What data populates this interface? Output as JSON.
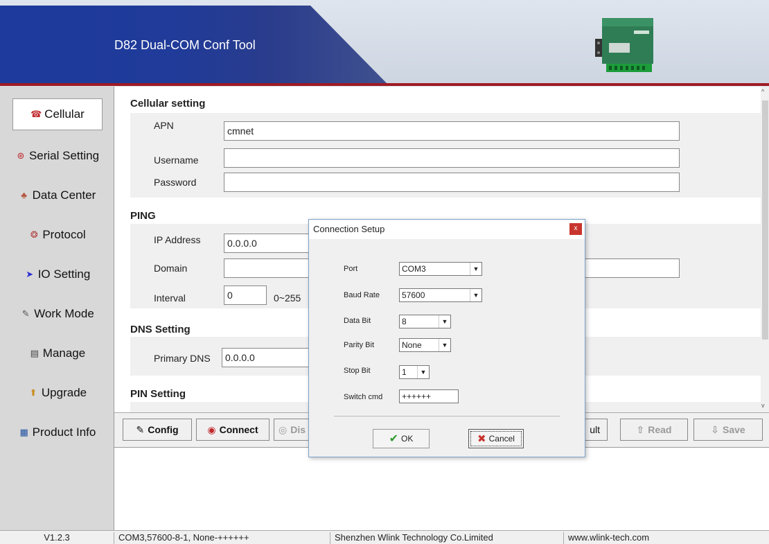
{
  "app": {
    "title": "D82 Dual-COM Conf Tool"
  },
  "sidebar": {
    "items": [
      {
        "label": "Cellular",
        "icon": "phone-icon"
      },
      {
        "label": "Serial Setting",
        "icon": "serial-icon"
      },
      {
        "label": "Data Center",
        "icon": "network-icon"
      },
      {
        "label": "Protocol",
        "icon": "protocol-icon"
      },
      {
        "label": "IO Setting",
        "icon": "arrow-right-icon"
      },
      {
        "label": "Work Mode",
        "icon": "wrench-icon"
      },
      {
        "label": "Manage",
        "icon": "manage-icon"
      },
      {
        "label": "Upgrade",
        "icon": "upgrade-icon"
      },
      {
        "label": "Product Info",
        "icon": "info-icon"
      }
    ],
    "active_index": 0
  },
  "main": {
    "cellular": {
      "title": "Cellular setting",
      "apn_label": "APN",
      "apn_value": "cmnet",
      "username_label": "Username",
      "username_value": "",
      "password_label": "Password",
      "password_value": ""
    },
    "ping": {
      "title": "PING",
      "ip_label": "IP Address",
      "ip_value": "0.0.0.0",
      "domain_label": "Domain",
      "domain_value": "",
      "interval_label": "Interval",
      "interval_value": "0",
      "interval_range": "0~255"
    },
    "dns": {
      "title": "DNS Setting",
      "primary_label": "Primary DNS",
      "primary_value": "0.0.0.0"
    },
    "pin": {
      "title": "PIN Setting"
    }
  },
  "toolbar": {
    "config": "Config",
    "connect": "Connect",
    "disconnect": "Dis",
    "default": "ult",
    "read": "Read",
    "save": "Save"
  },
  "statusbar": {
    "version": "V1.2.3",
    "connection": "COM3,57600-8-1, None-++++++",
    "company": "Shenzhen Wlink Technology Co.Limited",
    "website": "www.wlink-tech.com"
  },
  "dialog": {
    "title": "Connection Setup",
    "close": "x",
    "port_label": "Port",
    "port_value": "COM3",
    "baud_label": "Baud Rate",
    "baud_value": "57600",
    "databit_label": "Data Bit",
    "databit_value": "8",
    "parity_label": "Parity Bit",
    "parity_value": "None",
    "stopbit_label": "Stop Bit",
    "stopbit_value": "1",
    "switch_label": "Switch cmd",
    "switch_value": "++++++",
    "ok": "OK",
    "cancel": "Cancel"
  },
  "colors": {
    "header_blue": "#1d3a9c",
    "header_red_line": "#a01a22",
    "close_red": "#c8352e",
    "ok_green": "#2f9a2f",
    "cancel_red": "#c8352e"
  }
}
